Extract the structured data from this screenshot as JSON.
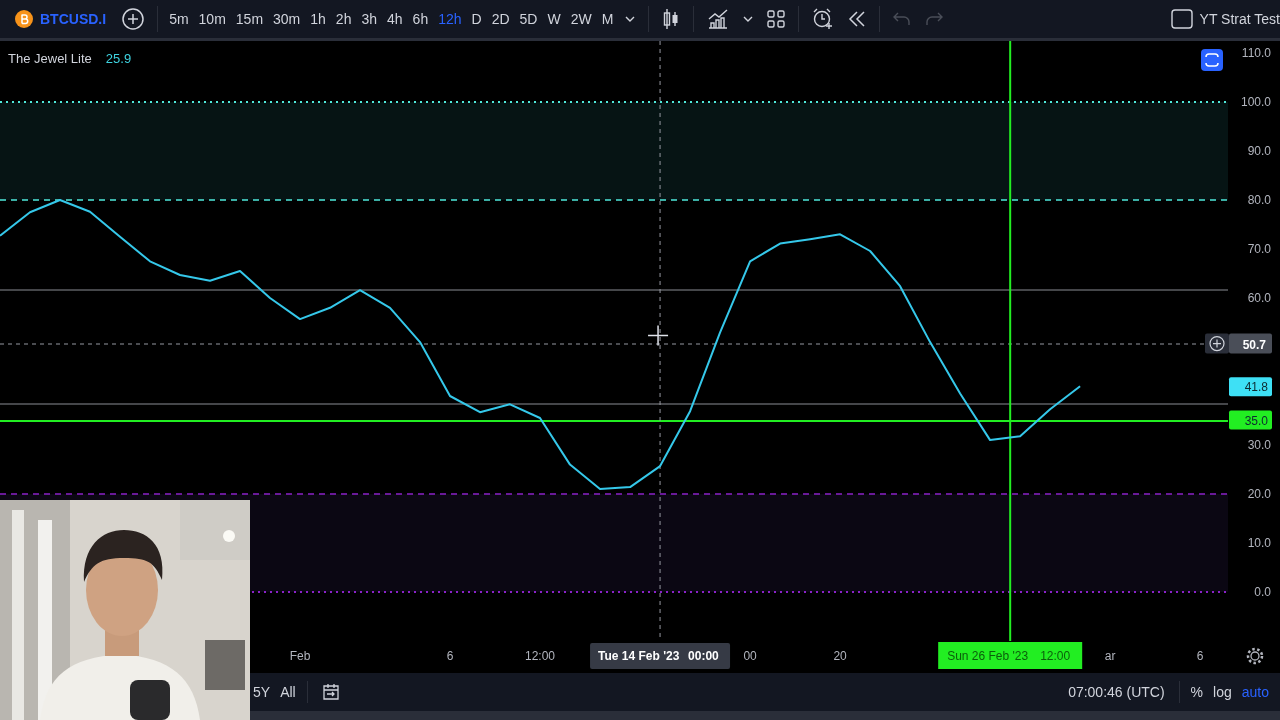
{
  "toolbar": {
    "symbol": "BTCUSD.I",
    "intervals": [
      {
        "label": "5m",
        "selected": false
      },
      {
        "label": "10m",
        "selected": false
      },
      {
        "label": "15m",
        "selected": false
      },
      {
        "label": "30m",
        "selected": false
      },
      {
        "label": "1h",
        "selected": false
      },
      {
        "label": "2h",
        "selected": false
      },
      {
        "label": "3h",
        "selected": false
      },
      {
        "label": "4h",
        "selected": false
      },
      {
        "label": "6h",
        "selected": false
      },
      {
        "label": "12h",
        "selected": true
      },
      {
        "label": "D",
        "selected": false
      },
      {
        "label": "2D",
        "selected": false
      },
      {
        "label": "5D",
        "selected": false
      },
      {
        "label": "W",
        "selected": false
      },
      {
        "label": "2W",
        "selected": false
      },
      {
        "label": "M",
        "selected": false
      }
    ],
    "undo": {
      "disabled": true
    },
    "redo": {
      "disabled": true
    },
    "layout_name": "YT Strat Test"
  },
  "indicator": {
    "value": "25.9"
  },
  "chart": {
    "chart_data": {
      "type": "line",
      "ylim": [
        0,
        110
      ],
      "yticks": [
        {
          "value": 0,
          "label": "0.0"
        },
        {
          "value": 10,
          "label": "10.0"
        },
        {
          "value": 20,
          "label": "20.0"
        },
        {
          "value": 30,
          "label": "30.0"
        },
        {
          "value": 60,
          "label": "60.0"
        },
        {
          "value": 70,
          "label": "70.0"
        },
        {
          "value": 80,
          "label": "80.0"
        },
        {
          "value": 90,
          "label": "90.0"
        },
        {
          "value": 100,
          "label": "100.0"
        },
        {
          "value": 110,
          "label": "110.0"
        }
      ],
      "categories": [
        null,
        null,
        null,
        null,
        null,
        null,
        null,
        null,
        null,
        null,
        "Feb",
        null,
        null,
        null,
        null,
        "6",
        null,
        null,
        "12:00",
        null,
        null,
        null,
        null,
        null,
        null,
        "00",
        null,
        null,
        "20",
        null,
        null,
        null,
        null,
        null,
        null,
        null,
        null,
        "ar",
        null,
        null,
        "6"
      ],
      "series": [
        {
          "name": "The Jewel Lite",
          "color": "#35c8ea",
          "values": [
            72.7,
            77.5,
            80,
            77.6,
            72.5,
            67.5,
            64.7,
            63.5,
            65.5,
            60,
            55.7,
            58,
            61.6,
            58,
            51,
            40,
            36.7,
            38.3,
            35.5,
            26,
            21,
            21.4,
            25.7,
            36.9,
            53,
            67.5,
            71.1,
            72,
            73,
            69.6,
            62.4,
            51,
            40.5,
            31,
            31.8,
            37.3,
            42,
            null,
            null,
            null,
            null
          ]
        }
      ],
      "bands": [
        {
          "axis": "y",
          "from": 80,
          "to": 100,
          "color": "#061414"
        },
        {
          "axis": "y",
          "from": 0,
          "to": 20,
          "color": "#0b0713"
        }
      ],
      "ref_lines": [
        {
          "axis": "y",
          "value": 100,
          "color": "#4fe8da"
        },
        {
          "axis": "y",
          "value": 80,
          "color": "#4fe8da"
        },
        {
          "axis": "y",
          "value": 61.6,
          "color": "#8a8d94"
        },
        {
          "axis": "y",
          "value": 38.4,
          "color": "#8a8d94"
        },
        {
          "axis": "y",
          "value": 35,
          "color": "#22ee22"
        },
        {
          "axis": "y",
          "value": 20,
          "color": "#8a22c8"
        },
        {
          "axis": "y",
          "value": 0,
          "color": "#8a22c8"
        },
        {
          "axis": "y",
          "value": 50.7,
          "color": "#9598a1"
        }
      ]
    },
    "marker": {
      "color": "#22ee22",
      "date": "Sun 26 Feb '23",
      "time": "12:00"
    },
    "crosshair": {
      "date": "Tue 14 Feb '23",
      "time": "00:00",
      "price": "50.7"
    },
    "price_tags": [
      {
        "text": "41.8",
        "color": "#3ee0f5"
      },
      {
        "text": "35.0",
        "color": "#22ee22"
      }
    ]
  },
  "bottom_bar": {
    "ranges": [
      {
        "label": "5Y",
        "selected": false
      },
      {
        "label": "All",
        "selected": false
      }
    ],
    "clock": "07:00:46 (UTC)",
    "scale": [
      {
        "label": "%",
        "selected": false
      },
      {
        "label": "log",
        "selected": false
      },
      {
        "label": "auto",
        "selected": true
      }
    ]
  }
}
